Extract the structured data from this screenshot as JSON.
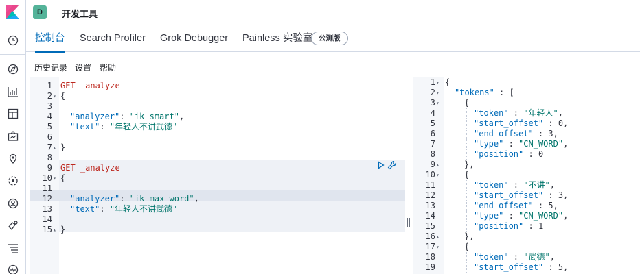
{
  "header": {
    "space_initial": "D",
    "app_title": "开发工具"
  },
  "tabs": [
    {
      "label": "控制台",
      "active": true
    },
    {
      "label": "Search Profiler",
      "active": false
    },
    {
      "label": "Grok Debugger",
      "active": false
    },
    {
      "label": "Painless 实验室",
      "active": false
    }
  ],
  "beta_badge": "公测版",
  "menu": {
    "history": "历史记录",
    "settings": "设置",
    "help": "帮助"
  },
  "sidenav_icons": [
    "clock-icon",
    "compass-icon",
    "visualize-icon",
    "dashboard-icon",
    "canvas-icon",
    "maps-icon",
    "ml-icon",
    "user-icon",
    "graph-icon",
    "stack-icon",
    "heartbeat-icon"
  ],
  "request_editor": {
    "lines": [
      {
        "n": "1",
        "fold": "",
        "text": "GET _analyze",
        "type": "method"
      },
      {
        "n": "2",
        "fold": "▾",
        "text": "{",
        "type": "punc"
      },
      {
        "n": "3",
        "fold": "",
        "text": "",
        "type": "punc"
      },
      {
        "n": "4",
        "fold": "",
        "key": "\"analyzer\"",
        "sep": ": ",
        "val": "\"ik_smart\"",
        "tail": ",",
        "type": "kv"
      },
      {
        "n": "5",
        "fold": "",
        "key": "\"text\"",
        "sep": ": ",
        "val": "\"年轻人不讲武德\"",
        "tail": "",
        "type": "kv"
      },
      {
        "n": "6",
        "fold": "",
        "text": "",
        "type": "punc"
      },
      {
        "n": "7",
        "fold": "▴",
        "text": "}",
        "type": "punc"
      },
      {
        "n": "8",
        "fold": "",
        "text": "",
        "type": "punc"
      },
      {
        "n": "9",
        "fold": "",
        "text": "GET _analyze",
        "type": "method"
      },
      {
        "n": "10",
        "fold": "▾",
        "text": "{",
        "type": "punc"
      },
      {
        "n": "11",
        "fold": "",
        "text": "",
        "type": "punc"
      },
      {
        "n": "12",
        "fold": "",
        "key": "\"analyzer\"",
        "sep": ": ",
        "val": "\"ik_max_word\"",
        "tail": ",",
        "type": "kv"
      },
      {
        "n": "13",
        "fold": "",
        "key": "\"text\"",
        "sep": ": ",
        "val": "\"年轻人不讲武德\"",
        "tail": "",
        "type": "kv"
      },
      {
        "n": "14",
        "fold": "",
        "text": "",
        "type": "punc"
      },
      {
        "n": "15",
        "fold": "▴",
        "text": "}",
        "type": "punc"
      }
    ]
  },
  "response_editor": {
    "lines": [
      {
        "n": "1",
        "fold": "▾",
        "indent": 0,
        "parts": [
          [
            "{",
            "punc"
          ]
        ]
      },
      {
        "n": "2",
        "fold": "▾",
        "indent": 1,
        "parts": [
          [
            "\"tokens\"",
            "key"
          ],
          [
            " : [",
            "punc"
          ]
        ]
      },
      {
        "n": "3",
        "fold": "▾",
        "indent": 2,
        "parts": [
          [
            "{",
            "punc"
          ]
        ]
      },
      {
        "n": "4",
        "fold": "",
        "indent": 3,
        "parts": [
          [
            "\"token\"",
            "key"
          ],
          [
            " : ",
            "punc"
          ],
          [
            "\"年轻人\"",
            "str"
          ],
          [
            ",",
            "punc"
          ]
        ]
      },
      {
        "n": "5",
        "fold": "",
        "indent": 3,
        "parts": [
          [
            "\"start_offset\"",
            "key"
          ],
          [
            " : ",
            "punc"
          ],
          [
            "0",
            "num"
          ],
          [
            ",",
            "punc"
          ]
        ]
      },
      {
        "n": "6",
        "fold": "",
        "indent": 3,
        "parts": [
          [
            "\"end_offset\"",
            "key"
          ],
          [
            " : ",
            "punc"
          ],
          [
            "3",
            "num"
          ],
          [
            ",",
            "punc"
          ]
        ]
      },
      {
        "n": "7",
        "fold": "",
        "indent": 3,
        "parts": [
          [
            "\"type\"",
            "key"
          ],
          [
            " : ",
            "punc"
          ],
          [
            "\"CN_WORD\"",
            "str"
          ],
          [
            ",",
            "punc"
          ]
        ]
      },
      {
        "n": "8",
        "fold": "",
        "indent": 3,
        "parts": [
          [
            "\"position\"",
            "key"
          ],
          [
            " : ",
            "punc"
          ],
          [
            "0",
            "num"
          ]
        ]
      },
      {
        "n": "9",
        "fold": "▴",
        "indent": 2,
        "parts": [
          [
            "},",
            "punc"
          ]
        ]
      },
      {
        "n": "10",
        "fold": "▾",
        "indent": 2,
        "parts": [
          [
            "{",
            "punc"
          ]
        ]
      },
      {
        "n": "11",
        "fold": "",
        "indent": 3,
        "parts": [
          [
            "\"token\"",
            "key"
          ],
          [
            " : ",
            "punc"
          ],
          [
            "\"不讲\"",
            "str"
          ],
          [
            ",",
            "punc"
          ]
        ]
      },
      {
        "n": "12",
        "fold": "",
        "indent": 3,
        "parts": [
          [
            "\"start_offset\"",
            "key"
          ],
          [
            " : ",
            "punc"
          ],
          [
            "3",
            "num"
          ],
          [
            ",",
            "punc"
          ]
        ]
      },
      {
        "n": "13",
        "fold": "",
        "indent": 3,
        "parts": [
          [
            "\"end_offset\"",
            "key"
          ],
          [
            " : ",
            "punc"
          ],
          [
            "5",
            "num"
          ],
          [
            ",",
            "punc"
          ]
        ]
      },
      {
        "n": "14",
        "fold": "",
        "indent": 3,
        "parts": [
          [
            "\"type\"",
            "key"
          ],
          [
            " : ",
            "punc"
          ],
          [
            "\"CN_WORD\"",
            "str"
          ],
          [
            ",",
            "punc"
          ]
        ]
      },
      {
        "n": "15",
        "fold": "",
        "indent": 3,
        "parts": [
          [
            "\"position\"",
            "key"
          ],
          [
            " : ",
            "punc"
          ],
          [
            "1",
            "num"
          ]
        ]
      },
      {
        "n": "16",
        "fold": "▴",
        "indent": 2,
        "parts": [
          [
            "},",
            "punc"
          ]
        ]
      },
      {
        "n": "17",
        "fold": "▾",
        "indent": 2,
        "parts": [
          [
            "{",
            "punc"
          ]
        ]
      },
      {
        "n": "18",
        "fold": "",
        "indent": 3,
        "parts": [
          [
            "\"token\"",
            "key"
          ],
          [
            " : ",
            "punc"
          ],
          [
            "\"武德\"",
            "str"
          ],
          [
            ",",
            "punc"
          ]
        ]
      },
      {
        "n": "19",
        "fold": "",
        "indent": 3,
        "parts": [
          [
            "\"start_offset\"",
            "key"
          ],
          [
            " : ",
            "punc"
          ],
          [
            "5",
            "num"
          ],
          [
            ",",
            "punc"
          ]
        ]
      }
    ]
  },
  "colors": {
    "accent": "#006bb8",
    "method": "#bd271e",
    "string": "#00756b",
    "avatar": "#54b399"
  }
}
